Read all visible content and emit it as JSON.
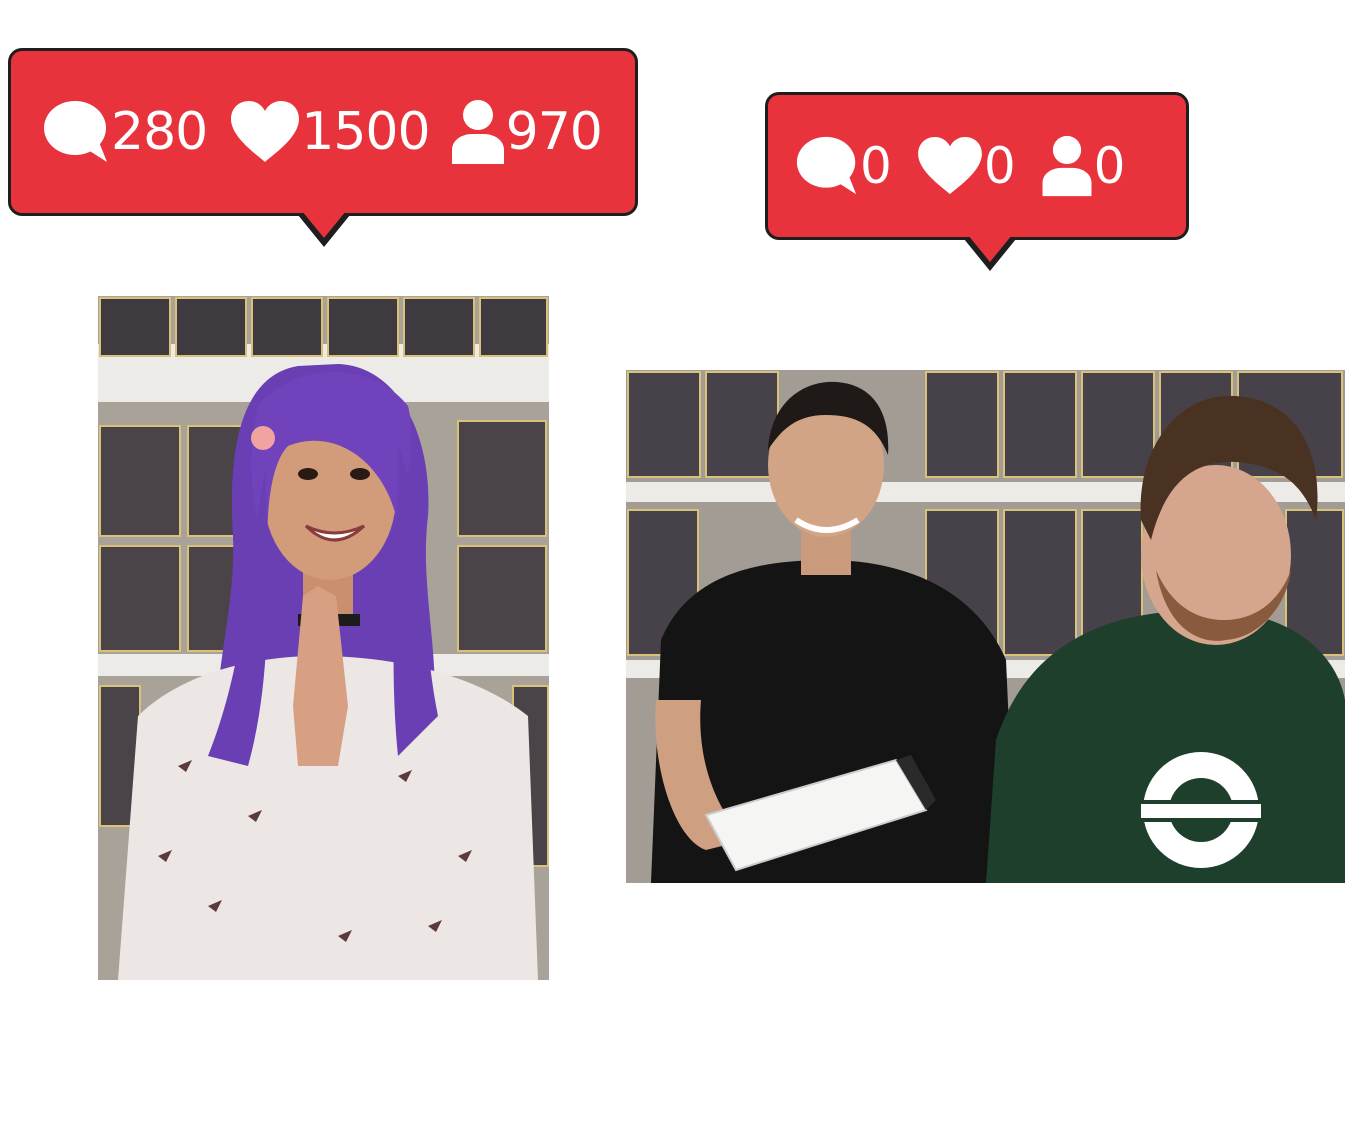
{
  "badges": {
    "left": {
      "comments": "280",
      "likes": "1500",
      "followers": "970"
    },
    "right": {
      "comments": "0",
      "likes": "0",
      "followers": "0"
    }
  },
  "icons": [
    "comment-bubble-icon",
    "heart-icon",
    "person-icon"
  ],
  "colors": {
    "badge_red": "#e8333d",
    "badge_border": "#1e1e1e",
    "icon_white": "#ffffff"
  },
  "photos": {
    "left": "woman with purple hair smiling in front of toy shelves",
    "right": "two men in front of toy shelves"
  }
}
